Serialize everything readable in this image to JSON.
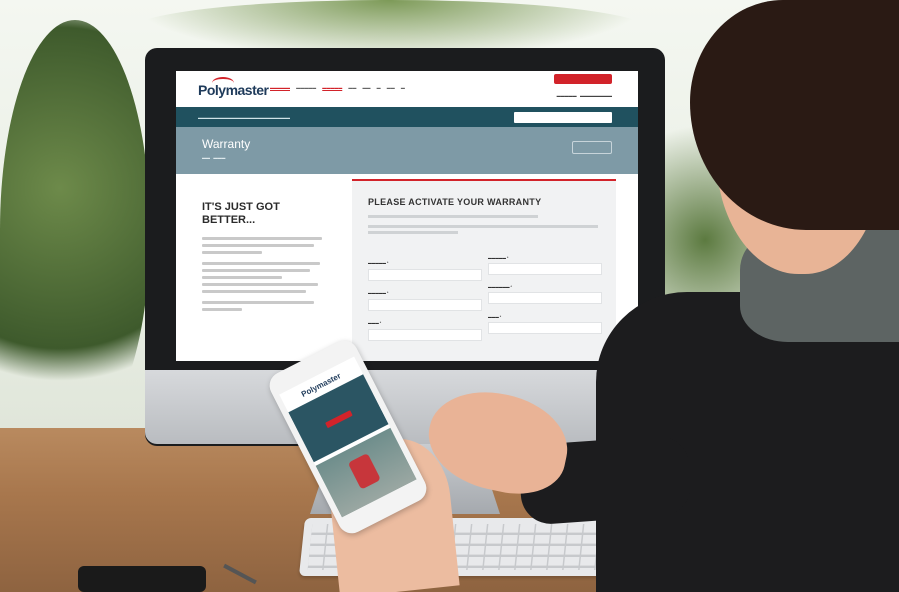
{
  "website": {
    "logo_text": "Polymaster",
    "page_title": "Warranty",
    "left_heading": "IT'S JUST GOT BETTER...",
    "form_heading": "PLEASE ACTIVATE YOUR WARRANTY"
  },
  "phone": {
    "logo_text": "Polymaster"
  },
  "colors": {
    "brand_red": "#d2232a",
    "header_teal": "#20515f",
    "title_bar": "#7e9aa6"
  }
}
